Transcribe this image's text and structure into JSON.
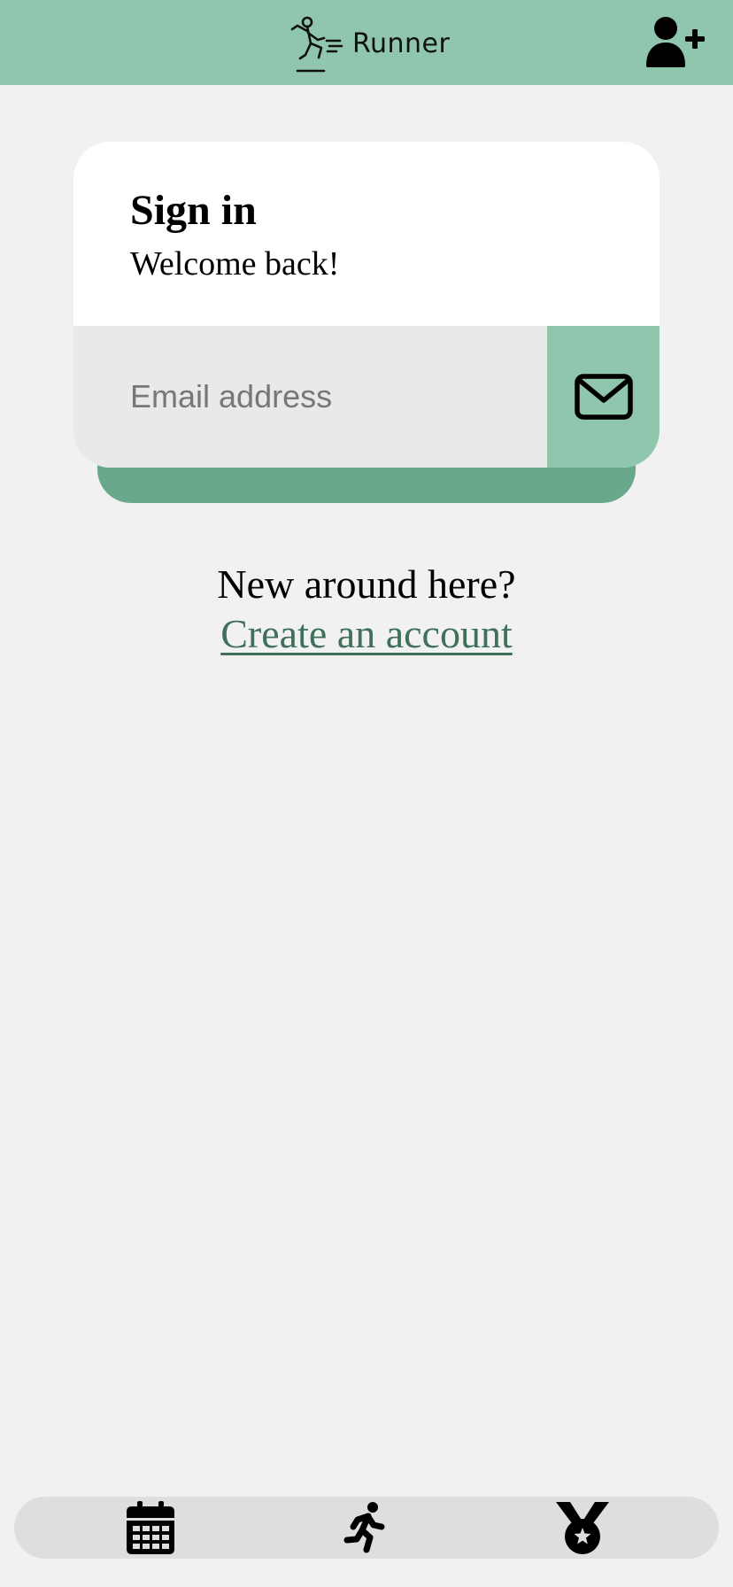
{
  "header": {
    "logo_text": "Runner",
    "icons": {
      "logo": "runner-logo-icon",
      "add_user": "user-plus-icon"
    },
    "colors": {
      "background": "#8fc6ad"
    }
  },
  "signin": {
    "title": "Sign in",
    "subtitle": "Welcome back!",
    "email_placeholder": "Email address",
    "email_value": "",
    "submit_icon": "envelope-icon",
    "colors": {
      "card": "#ffffff",
      "input": "#e9e9e9",
      "accent": "#8fc6ad",
      "shadow": "#6aa88c"
    }
  },
  "signup": {
    "prompt": "New around here?",
    "link_label": "Create an account",
    "link_color": "#40705a"
  },
  "bottom_nav": {
    "items": [
      {
        "icon": "calendar-icon"
      },
      {
        "icon": "running-person-icon"
      },
      {
        "icon": "medal-icon"
      }
    ]
  }
}
